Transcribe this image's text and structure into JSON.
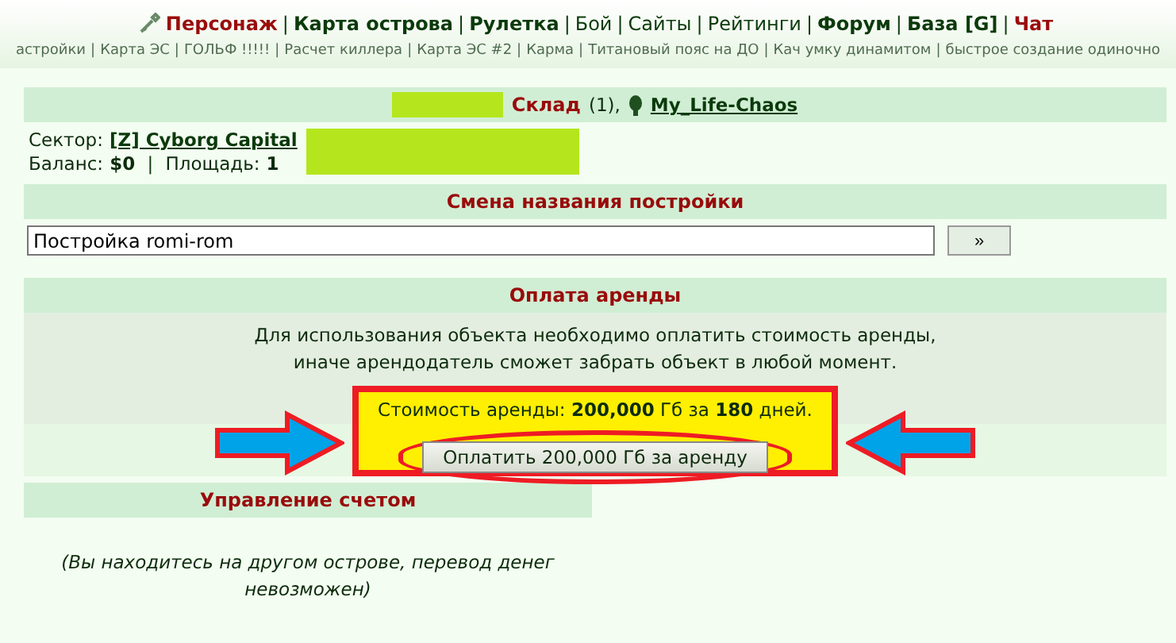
{
  "nav": {
    "separator": "|",
    "items": [
      {
        "label": "Персонаж",
        "kind": "red"
      },
      {
        "label": "Карта острова",
        "kind": "bold"
      },
      {
        "label": "Рулетка",
        "kind": "bold"
      },
      {
        "label": "Бой",
        "kind": "plain"
      },
      {
        "label": "Сайты",
        "kind": "plain"
      },
      {
        "label": "Рейтинги",
        "kind": "plain"
      },
      {
        "label": "Форум",
        "kind": "bold"
      },
      {
        "label": "База [G]",
        "kind": "bold"
      },
      {
        "label": "Чат",
        "kind": "red"
      }
    ],
    "links": [
      "астройки",
      "Карта ЭС",
      "ГОЛЬФ !!!!!",
      "Расчет киллера",
      "Карта ЭС #2",
      "Карма",
      "Титановый пояс на ДО",
      "Кач умку динамитом",
      "быстрое создание одиночно"
    ]
  },
  "building": {
    "title": "Склад",
    "count": "(1),",
    "owner": "My_Life-Chaos",
    "sector_label": "Сектор:",
    "sector": "[Z] Cyborg Capital",
    "balance_label": "Баланс:",
    "balance": "$0",
    "separator": "|",
    "area_label": "Площадь:",
    "area": "1"
  },
  "rename": {
    "title": "Смена названия постройки",
    "value": "Постройка romi-rom",
    "button": "»"
  },
  "rent": {
    "title": "Оплата аренды",
    "message": "Для использования объекта необходимо оплатить стоимость аренды,\nиначе арендодатель сможет забрать объект в любой момент.",
    "cost": "Стоимость аренды: **200,000** Гб за **180** дней.",
    "button": "Оплатить 200,000 Гб за аренду"
  },
  "account": {
    "title": "Управление счетом",
    "note": "(Вы находитесь на другом острове, перевод денег невозможен)"
  }
}
